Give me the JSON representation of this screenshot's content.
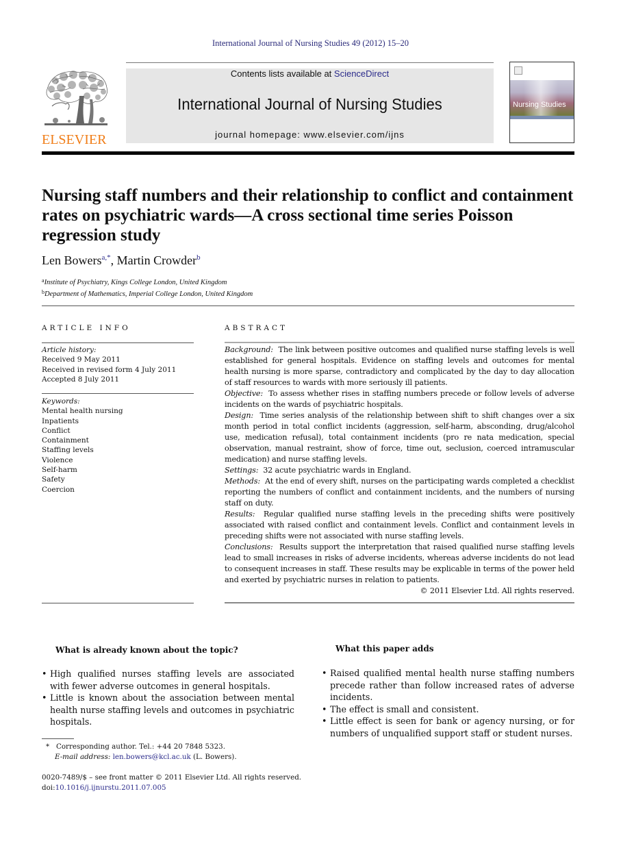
{
  "citation": "International Journal of Nursing Studies 49 (2012) 15–20",
  "masthead": {
    "publisher": "ELSEVIER",
    "contents_prefix": "Contents lists available at ",
    "contents_link": "ScienceDirect",
    "journal_name": "International Journal of Nursing Studies",
    "homepage": "journal homepage: www.elsevier.com/ijns",
    "cover_title": "Nursing Studies"
  },
  "article": {
    "title": "Nursing staff numbers and their relationship to conflict and containment rates on psychiatric wards—A cross sectional time series Poisson regression study",
    "authors": [
      {
        "name": "Len Bowers",
        "sup": "a,*"
      },
      {
        "name": "Martin Crowder",
        "sup": "b"
      }
    ],
    "author_separator": ", ",
    "affiliations": [
      {
        "sup": "a",
        "text": "Institute of Psychiatry, Kings College London, United Kingdom"
      },
      {
        "sup": "b",
        "text": "Department of Mathematics, Imperial College London, United Kingdom"
      }
    ]
  },
  "article_info": {
    "heading": "ARTICLE INFO",
    "history_label": "Article history:",
    "history": [
      "Received 9 May 2011",
      "Received in revised form 4 July 2011",
      "Accepted 8 July 2011"
    ],
    "keywords_label": "Keywords:",
    "keywords": [
      "Mental health nursing",
      "Inpatients",
      "Conflict",
      "Containment",
      "Staffing levels",
      "Violence",
      "Self-harm",
      "Safety",
      "Coercion"
    ]
  },
  "abstract": {
    "heading": "ABSTRACT",
    "sections": [
      {
        "label": "Background:",
        "text": "The link between positive outcomes and qualified nurse staffing levels is well established for general hospitals. Evidence on staffing levels and outcomes for mental health nursing is more sparse, contradictory and complicated by the day to day allocation of staff resources to wards with more seriously ill patients."
      },
      {
        "label": "Objective:",
        "text": "To assess whether rises in staffing numbers precede or follow levels of adverse incidents on the wards of psychiatric hospitals."
      },
      {
        "label": "Design:",
        "text": "Time series analysis of the relationship between shift to shift changes over a six month period in total conflict incidents (aggression, self-harm, absconding, drug/alcohol use, medication refusal), total containment incidents (pro re nata medication, special observation, manual restraint, show of force, time out, seclusion, coerced intramuscular medication) and nurse staffing levels."
      },
      {
        "label": "Settings:",
        "text": "32 acute psychiatric wards in England."
      },
      {
        "label": "Methods:",
        "text": "At the end of every shift, nurses on the participating wards completed a checklist reporting the numbers of conflict and containment incidents, and the numbers of nursing staff on duty."
      },
      {
        "label": "Results:",
        "text": "Regular qualified nurse staffing levels in the preceding shifts were positively associated with raised conflict and containment levels. Conflict and containment levels in preceding shifts were not associated with nurse staffing levels."
      },
      {
        "label": "Conclusions:",
        "text": "Results support the interpretation that raised qualified nurse staffing levels lead to small increases in risks of adverse incidents, whereas adverse incidents do not lead to consequent increases in staff. These results may be explicable in terms of the power held and exerted by psychiatric nurses in relation to patients."
      }
    ],
    "copyright": "© 2011 Elsevier Ltd. All rights reserved."
  },
  "known": {
    "heading": "What is already known about the topic?",
    "items": [
      "High qualified nurses staffing levels are associated with fewer adverse outcomes in general hospitals.",
      "Little is known about the association between mental health nurse staffing levels and outcomes in psychiatric hospitals."
    ]
  },
  "adds": {
    "heading": "What this paper adds",
    "items": [
      "Raised qualified mental health nurse staffing numbers precede rather than follow increased rates of adverse incidents.",
      "The effect is small and consistent.",
      "Little effect is seen for bank or agency nursing, or for numbers of unqualified support staff or student nurses."
    ]
  },
  "footnote": {
    "marker": "*",
    "corresponding": "Corresponding author. Tel.: +44 20 7848 5323.",
    "email_label": "E-mail address:",
    "email": "len.bowers@kcl.ac.uk",
    "email_suffix": "(L. Bowers)."
  },
  "frontmatter": {
    "issn_line": "0020-7489/$ – see front matter © 2011 Elsevier Ltd. All rights reserved.",
    "doi_prefix": "doi:",
    "doi": "10.1016/j.ijnurstu.2011.07.005"
  },
  "bullet_glyph": "•"
}
